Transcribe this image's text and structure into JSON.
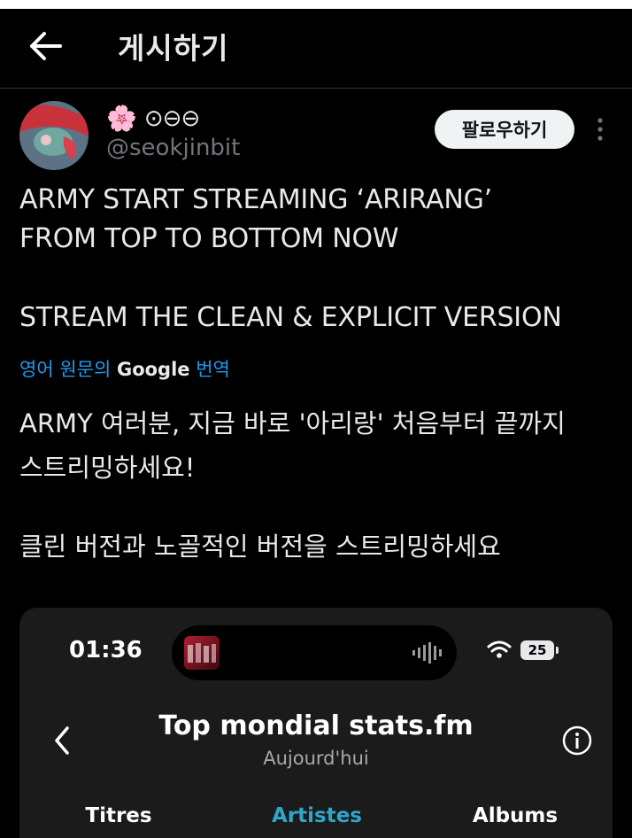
{
  "header": {
    "title": "게시하기"
  },
  "post": {
    "display_name_emoji": "🌸",
    "display_name": "⊙⊖⊖",
    "handle": "@seokjinbit",
    "follow_label": "팔로우하기",
    "english_lines": [
      "ARMY START STREAMING ‘ARIRANG’",
      "FROM TOP TO BOTTOM NOW",
      "STREAM THE CLEAN & EXPLICIT VERSION"
    ],
    "translate": {
      "prefix": "영어 원문의",
      "google": "Google",
      "suffix": "번역"
    },
    "korean_lines": [
      "ARMY 여러분, 지금 바로 '아리랑' 처음부터 끝까지",
      "스트리밍하세요!",
      "클린 버전과 노골적인 버전을 스트리밍하세요"
    ]
  },
  "media": {
    "status_time": "01:36",
    "battery": "25",
    "title": "Top mondial stats.fm",
    "subtitle": "Aujourd'hui",
    "tabs": [
      {
        "label": "Titres",
        "active": false
      },
      {
        "label": "Artistes",
        "active": true
      },
      {
        "label": "Albums",
        "active": false
      }
    ],
    "active_tab_color": "#2fa6c9"
  },
  "colors": {
    "background": "#000000",
    "link_blue": "#1d9bf0",
    "text": "#e7e9ea",
    "muted": "#71767b"
  }
}
